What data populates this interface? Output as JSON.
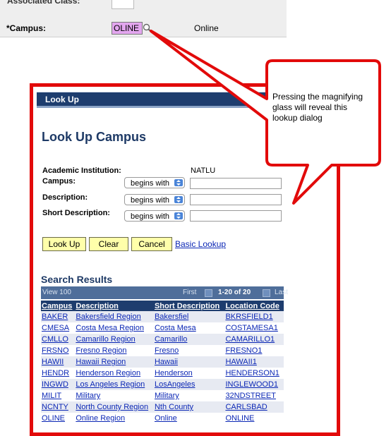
{
  "top": {
    "prev_label": "Associated Class:",
    "campus_label": "*Campus:",
    "campus_value": "OLINE",
    "campus_description": "Online"
  },
  "callout": {
    "text": "Pressing the magnifying glass will reveal this lookup dialog"
  },
  "dialog": {
    "header": "Look Up",
    "title": "Look Up Campus",
    "academic_institution_label": "Academic Institution:",
    "academic_institution_value": "NATLU",
    "fields": [
      {
        "label": "Campus:",
        "operator": "begins with",
        "value": ""
      },
      {
        "label": "Description:",
        "operator": "begins with",
        "value": ""
      },
      {
        "label": "Short Description:",
        "operator": "begins with",
        "value": ""
      }
    ],
    "buttons": {
      "lookup": "Look Up",
      "clear": "Clear",
      "cancel": "Cancel",
      "basic_lookup": "Basic Lookup"
    },
    "results": {
      "title": "Search Results",
      "view_all": "View 100",
      "first": "First",
      "range": "1-20 of 20",
      "last": "Last",
      "columns": [
        "Campus",
        "Description",
        "Short Description",
        "Location Code"
      ],
      "rows": [
        [
          "BAKER",
          "Bakersfield Region",
          "Bakersfiel",
          "BKRSFIELD1"
        ],
        [
          "CMESA",
          "Costa Mesa Region",
          "Costa Mesa",
          "COSTAMESA1"
        ],
        [
          "CMLLO",
          "Camarillo Region",
          "Camarillo",
          "CAMARILLO1"
        ],
        [
          "FRSNO",
          "Fresno Region",
          "Fresno",
          "FRESNO1"
        ],
        [
          "HAWII",
          "Hawaii Region",
          "Hawaii",
          "HAWAII1"
        ],
        [
          "HENDR",
          "Henderson Region",
          "Henderson",
          "HENDERSON1"
        ],
        [
          "INGWD",
          "Los Angeles Region",
          "LosAngeles",
          "INGLEWOOD1"
        ],
        [
          "MILIT",
          "Military",
          "Military",
          "32NDSTREET"
        ],
        [
          "NCNTY",
          "North County Region",
          "Nth County",
          "CARLSBAD"
        ],
        [
          "OLINE",
          "Online Region",
          "Online",
          "ONLINE"
        ]
      ]
    }
  },
  "colors": {
    "highlight": "#e20a0a",
    "header_bg": "#1e3d6e",
    "button_bg": "#ffffaa",
    "link": "#0b27b5",
    "campus_input_bg": "#e3a6ef"
  }
}
